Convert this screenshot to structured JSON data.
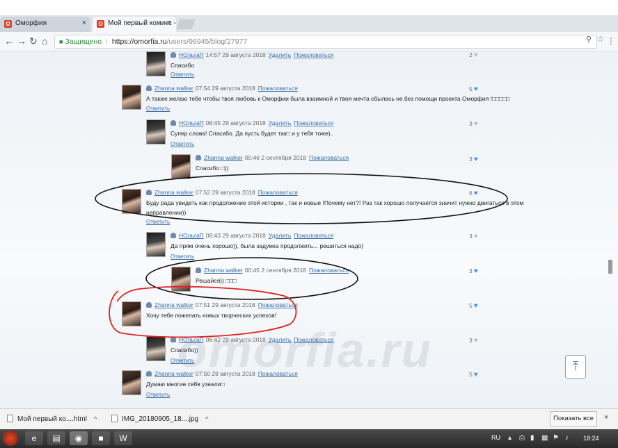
{
  "browser": {
    "tabs": [
      {
        "title": "Оморфия",
        "favicon": "O"
      },
      {
        "title": "Мой первый комикс - в",
        "favicon": "O"
      }
    ],
    "secure_label": "Защищено",
    "url_host": "https://omorfia.ru",
    "url_path": "/users/96945/blog/27977"
  },
  "labels": {
    "delete": "Удалить",
    "report": "Пожаловаться",
    "reply": "Ответить"
  },
  "comments": [
    {
      "author": "НОльгаП",
      "time": "14:57 29 августа 2018",
      "has_delete": true,
      "text": "Спасибо",
      "likes": "2",
      "liked": false
    },
    {
      "author": "Zhanna walker",
      "time": "07:54 29 августа 2018",
      "has_delete": false,
      "text": "А также желаю тебе чтобы твоя любовь к Оморфии была взаимной и твоя мечта сбылась не без помощи проекта Оморфия !□□□□□",
      "likes": "5",
      "liked": true
    },
    {
      "author": "НОльгаП",
      "time": "08:45 29 августа 2018",
      "has_delete": true,
      "text": "Супер слова! Спасибо. Да пусть будет так□ и у тебя тоже)..",
      "likes": "3",
      "liked": false
    },
    {
      "author": "Zhanna walker",
      "time": "00:46 2 сентября 2018",
      "has_delete": false,
      "text": "Спасибо □))",
      "likes": "3",
      "liked": true
    },
    {
      "author": "Zhanna walker",
      "time": "07:52 29 августа 2018",
      "has_delete": false,
      "text": "Буду рада увидеть как продолжение этой истории , так и новые !Почему нет?! Раз так хорошо получается значит нужно двигаться в этом",
      "text2": "направлении))",
      "likes": "6",
      "liked": true
    },
    {
      "author": "НОльгаП",
      "time": "08:43 29 августа 2018",
      "has_delete": true,
      "text": "Да прям очень хорошо)), была задумка продолжить... решиться надо)",
      "likes": "3",
      "liked": false
    },
    {
      "author": "Zhanna walker",
      "time": "00:45 2 сентября 2018",
      "has_delete": false,
      "text": "Решайся)) □□□",
      "likes": "3",
      "liked": true
    },
    {
      "author": "Zhanna walker",
      "time": "07:51 29 августа 2018",
      "has_delete": false,
      "text": "Хочу тебе пожелать новых творческих успехов!",
      "likes": "5",
      "liked": true
    },
    {
      "author": "НОльгаП",
      "time": "08:42 29 августа 2018",
      "has_delete": true,
      "text": "Спасибо))",
      "likes": "3",
      "liked": false
    },
    {
      "author": "Zhanna walker",
      "time": "07:50 29 августа 2018",
      "has_delete": false,
      "text": "Думаю многие себя узнали□",
      "likes": "5",
      "liked": true
    }
  ],
  "watermark": "omorfia.ru",
  "downloads": {
    "items": [
      "Мой первый ко....html",
      "IMG_20180905_18....jpg"
    ],
    "show_all": "Показать все"
  },
  "taskbar": {
    "lang": "RU",
    "clock": "18:24"
  },
  "colors": {
    "link": "#3a6ea5",
    "annotation_black": "#111111",
    "annotation_red": "#e02020",
    "heart": "#4a90d9"
  }
}
